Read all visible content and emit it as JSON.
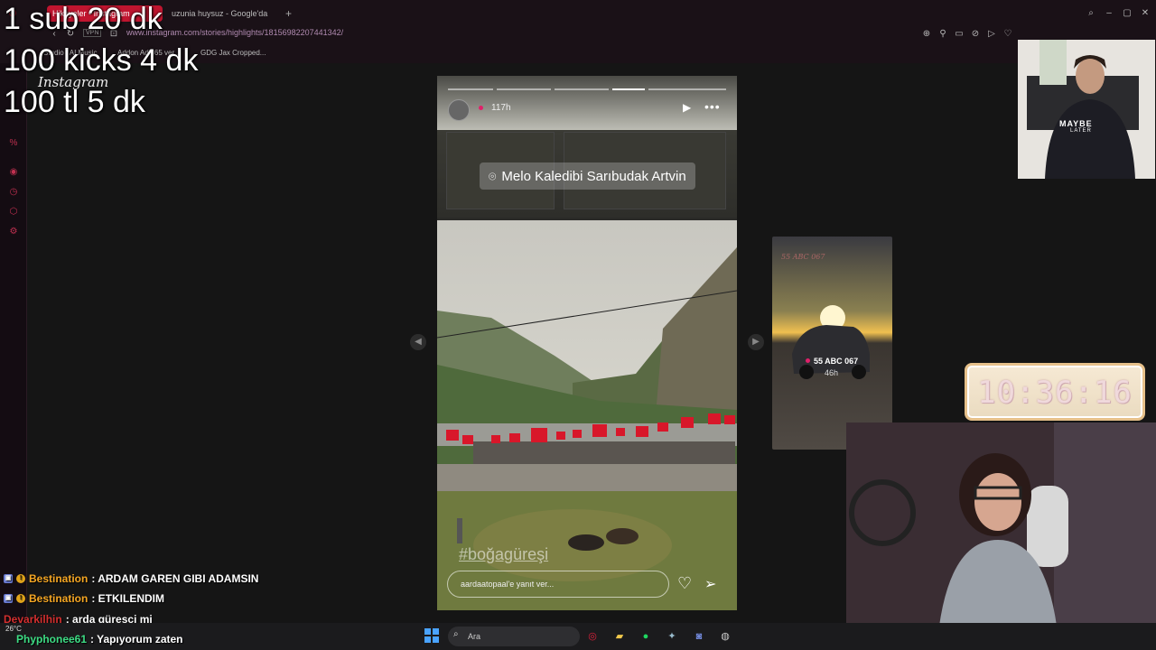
{
  "browser": {
    "tabs": [
      {
        "label": "Hikayeler • Instagram"
      },
      {
        "label": "uzunia huysuz - Google'da"
      }
    ],
    "new_tab_label": "+",
    "vpn_label": "VPN",
    "url": "www.instagram.com/stories/highlights/18156982207441342/",
    "bookmarks": [
      "Studio | AI Music",
      "Addon Adi365 ver...",
      "GDG Jax Cropped..."
    ]
  },
  "overlays": [
    "1 sub 20 dk",
    "100 kicks 4 dk",
    "100 tl 5 dk"
  ],
  "instagram": {
    "logo": "Instagram",
    "story": {
      "time": "117h",
      "location": "Melo Kaledibi Sarıbudak Artvin",
      "hashtag": "#boğagüreşi",
      "reply_placeholder": "aardaatopaal'e yanıt ver..."
    },
    "next_story": {
      "plate_text": "55 ABC 067",
      "title": "55 ABC 067",
      "time": "46h"
    }
  },
  "clock": "10:36:16",
  "chat": [
    {
      "user": "Bestination",
      "message": ": ARDAM GAREN GIBI ADAMSIN",
      "color": "#f5a623"
    },
    {
      "user": "Bestination",
      "message": ": ETKILENDIM",
      "color": "#f5a623"
    },
    {
      "user": "Devarkilhin",
      "message": ": arda güreşçi mi",
      "color": "#d32f2f"
    },
    {
      "user": "Phyphonee61",
      "message": ": Yapıyorum zaten",
      "color": "#3ddc84"
    }
  ],
  "taskbar": {
    "weather_temp": "26°C",
    "search_label": "Ara"
  },
  "colors": {
    "accent": "#c0152f",
    "chat_highlight": "#f5a623"
  }
}
